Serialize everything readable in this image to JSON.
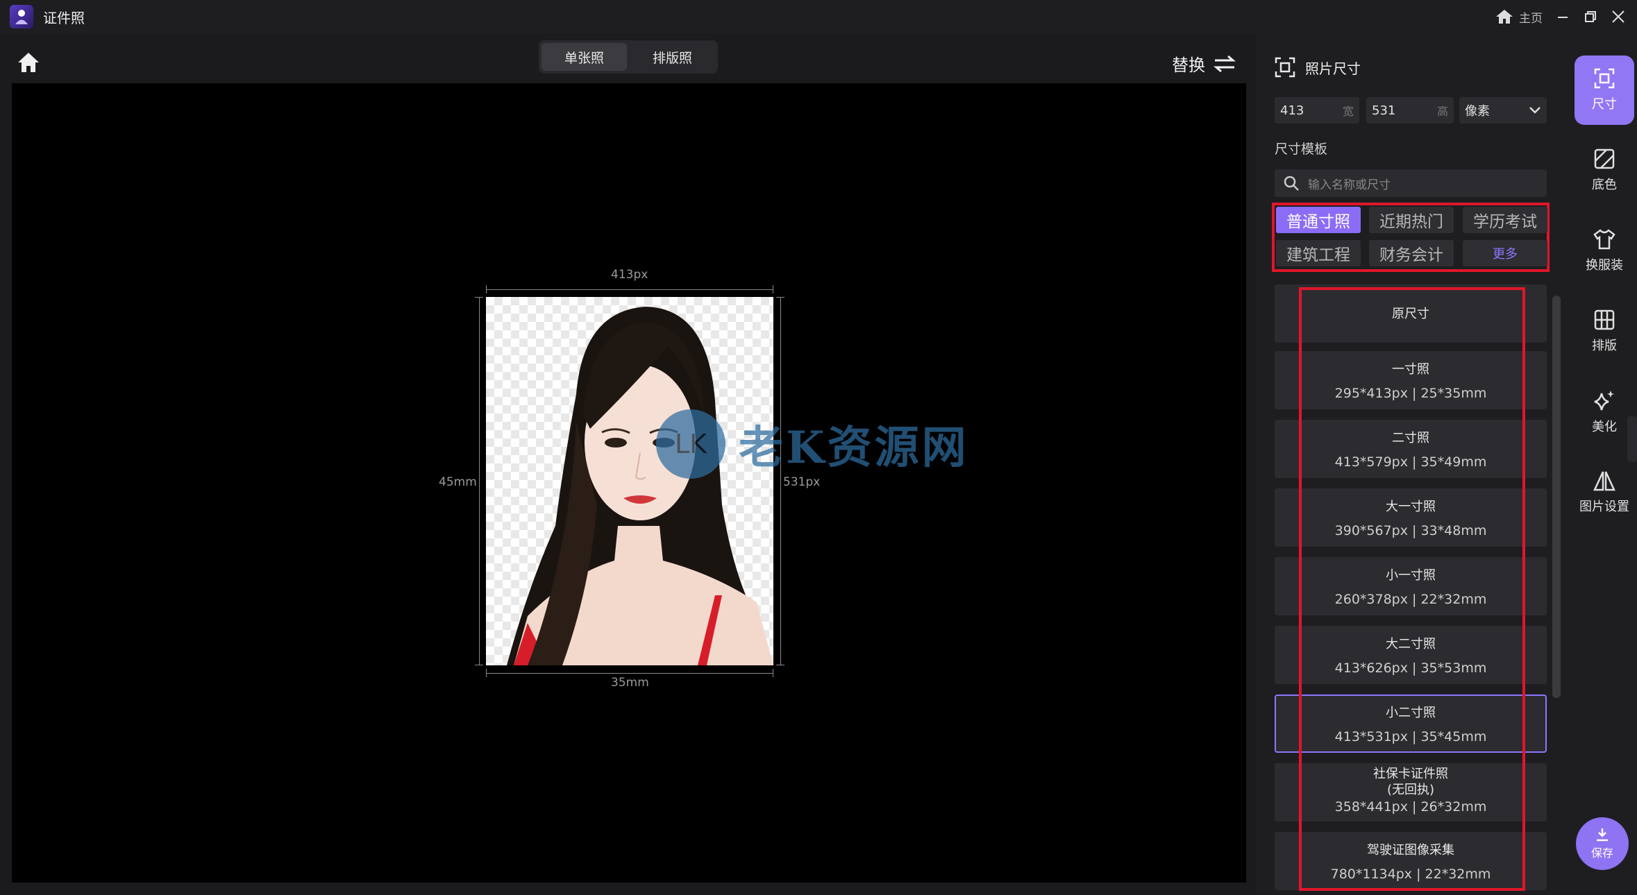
{
  "window": {
    "title": "证件照",
    "home_label": "主页"
  },
  "toolbar": {
    "tabs": [
      {
        "label": "单张照",
        "active": true
      },
      {
        "label": "排版照",
        "active": false
      }
    ],
    "replace_label": "替换"
  },
  "canvas": {
    "top_dim": "413px",
    "right_dim": "531px",
    "left_dim": "45mm",
    "bottom_dim": "35mm",
    "watermark": "老K资源网"
  },
  "panel": {
    "title": "照片尺寸",
    "width_value": "413",
    "width_unit": "宽",
    "height_value": "531",
    "height_unit": "高",
    "unit_select": "像素",
    "template_label": "尺寸模板",
    "search_placeholder": "输入名称或尺寸",
    "tags": [
      "普通寸照",
      "近期热门",
      "学历考试",
      "建筑工程",
      "财务会计",
      "更多"
    ],
    "sizes": [
      {
        "name": "原尺寸",
        "spec": ""
      },
      {
        "name": "一寸照",
        "spec": "295*413px | 25*35mm"
      },
      {
        "name": "二寸照",
        "spec": "413*579px | 35*49mm"
      },
      {
        "name": "大一寸照",
        "spec": "390*567px | 33*48mm"
      },
      {
        "name": "小一寸照",
        "spec": "260*378px | 22*32mm"
      },
      {
        "name": "大二寸照",
        "spec": "413*626px | 35*53mm"
      },
      {
        "name": "小二寸照",
        "spec": "413*531px | 35*45mm",
        "selected": true
      },
      {
        "name": "社保卡证件照\n(无回执)",
        "spec": "358*441px | 26*32mm"
      },
      {
        "name": "驾驶证图像采集",
        "spec": "780*1134px | 22*32mm"
      }
    ]
  },
  "rail": {
    "items": [
      {
        "label": "尺寸",
        "icon": "crop-frame-icon",
        "active": true
      },
      {
        "label": "底色",
        "icon": "background-color-icon"
      },
      {
        "label": "换服装",
        "icon": "shirt-icon"
      },
      {
        "label": "排版",
        "icon": "grid-icon"
      },
      {
        "label": "美化",
        "icon": "sparkle-icon"
      },
      {
        "label": "图片设置",
        "icon": "mirror-icon"
      }
    ],
    "save_label": "保存"
  },
  "colors": {
    "accent": "#8c77ff",
    "highlight_red": "#e0162b"
  }
}
